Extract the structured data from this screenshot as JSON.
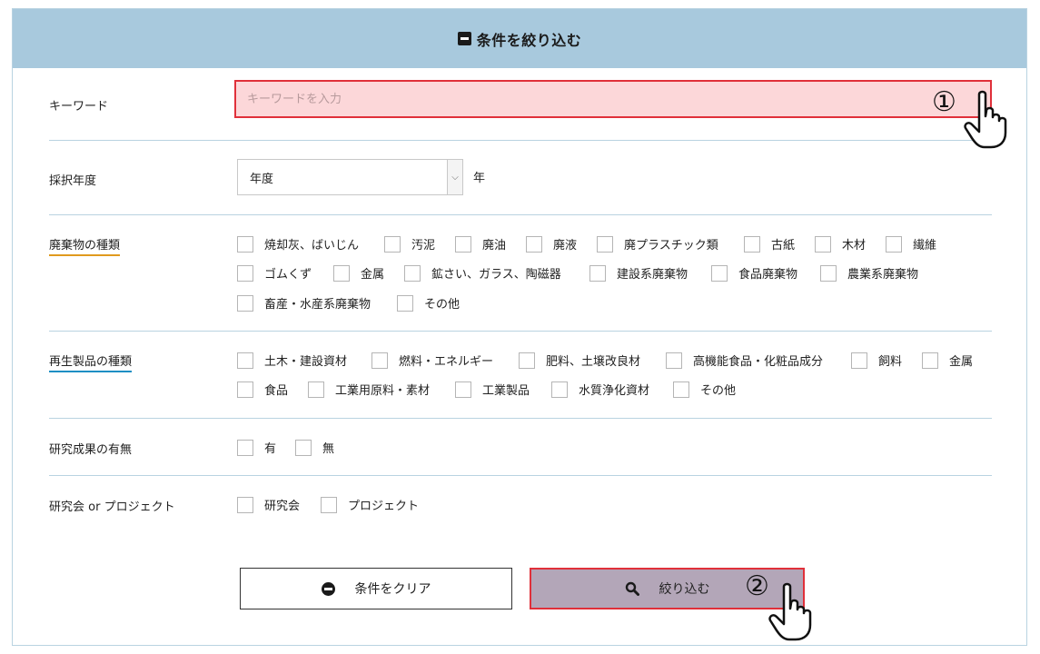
{
  "header": {
    "title": "条件を絞り込む"
  },
  "keyword": {
    "label": "キーワード",
    "placeholder": "キーワードを入力",
    "value": ""
  },
  "year": {
    "label": "採択年度",
    "selected": "年度",
    "suffix": "年"
  },
  "waste": {
    "label": "廃棄物の種類",
    "options": [
      "焼却灰、ばいじん",
      "汚泥",
      "廃油",
      "廃液",
      "廃プラスチック類",
      "古紙",
      "木材",
      "繊維",
      "ゴムくず",
      "金属",
      "鉱さい、ガラス、陶磁器",
      "建設系廃棄物",
      "食品廃棄物",
      "農業系廃棄物",
      "畜産・水産系廃棄物",
      "その他"
    ]
  },
  "recycled": {
    "label": "再生製品の種類",
    "options": [
      "土木・建設資材",
      "燃料・エネルギー",
      "肥料、土壌改良材",
      "高機能食品・化粧品成分",
      "飼料",
      "金属",
      "食品",
      "工業用原料・素材",
      "工業製品",
      "水質浄化資材",
      "その他"
    ]
  },
  "results": {
    "label": "研究成果の有無",
    "options": [
      "有",
      "無"
    ]
  },
  "type": {
    "label": "研究会 or プロジェクト",
    "options": [
      "研究会",
      "プロジェクト"
    ]
  },
  "buttons": {
    "clear": "条件をクリア",
    "filter": "絞り込む"
  },
  "annotations": {
    "step1": "①",
    "step2": "②"
  },
  "colors": {
    "header_bg": "#a8c9dd",
    "highlight_border": "#e0303a",
    "keyword_bg": "#fcd7d9",
    "filter_bg": "#b3a6b8",
    "underline_orange": "#e09a1e",
    "underline_blue": "#1e8fc4"
  }
}
